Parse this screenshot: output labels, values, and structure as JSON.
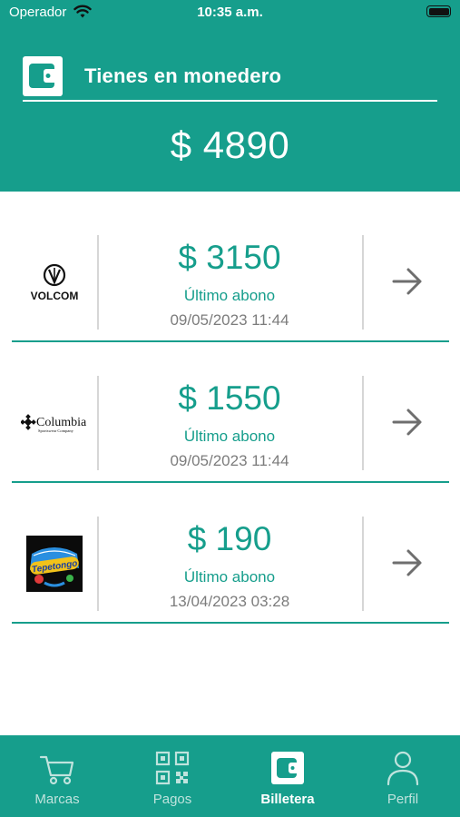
{
  "status_bar": {
    "carrier": "Operador",
    "time": "10:35 a.m."
  },
  "header": {
    "title": "Tienes en monedero",
    "balance": "$ 4890",
    "icon": "wallet-icon"
  },
  "cards": [
    {
      "brand": "VOLCOM",
      "amount": "$ 3150",
      "label": "Último abono",
      "date": "09/05/2023 11:44"
    },
    {
      "brand": "Columbia",
      "brand_sub": "Sportswear Company",
      "amount": "$ 1550",
      "label": "Último abono",
      "date": "09/05/2023 11:44"
    },
    {
      "brand": "Tepetongo",
      "amount": "$ 190",
      "label": "Último abono",
      "date": "13/04/2023 03:28"
    }
  ],
  "tabs": [
    {
      "label": "Marcas",
      "icon": "cart-icon",
      "active": false
    },
    {
      "label": "Pagos",
      "icon": "qr-code-icon",
      "active": false
    },
    {
      "label": "Billetera",
      "icon": "wallet-icon",
      "active": true
    },
    {
      "label": "Perfil",
      "icon": "user-icon",
      "active": false
    }
  ],
  "colors": {
    "primary": "#169e8c",
    "inactive_tab": "#bfe3dd",
    "muted_text": "#7c7c7c",
    "divider": "#d6d6d6"
  }
}
